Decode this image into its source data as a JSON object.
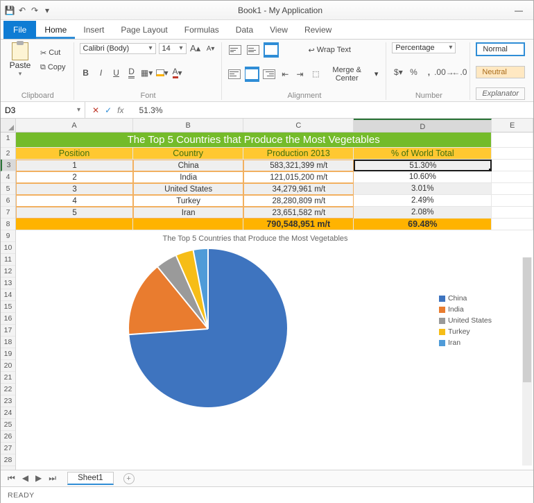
{
  "window": {
    "title": "Book1 - My Application"
  },
  "tabs": {
    "file": "File",
    "home": "Home",
    "insert": "Insert",
    "page_layout": "Page Layout",
    "formulas": "Formulas",
    "data": "Data",
    "view": "View",
    "review": "Review",
    "active": "Home"
  },
  "ribbon": {
    "clipboard": {
      "paste": "Paste",
      "cut": "Cut",
      "copy": "Copy",
      "label": "Clipboard"
    },
    "font": {
      "name_sel": "Calibri (Body)",
      "size_sel": "14",
      "label": "Font"
    },
    "alignment": {
      "wrap": "Wrap Text",
      "merge": "Merge & Center",
      "label": "Alignment"
    },
    "number": {
      "format_sel": "Percentage",
      "label": "Number"
    },
    "styles": {
      "normal": "Normal",
      "neutral": "Neutral",
      "explan": "Explanator"
    }
  },
  "formula_bar": {
    "cellref": "D3",
    "value": "51.3%"
  },
  "columns": {
    "A": "A",
    "B": "B",
    "C": "C",
    "D": "D",
    "E": "E"
  },
  "rows_labels": [
    "1",
    "2",
    "3",
    "4",
    "5",
    "6",
    "7",
    "8",
    "9",
    "10",
    "11",
    "12",
    "13",
    "14",
    "15",
    "16",
    "17",
    "18",
    "19",
    "20",
    "21",
    "22",
    "23",
    "24",
    "25",
    "26",
    "27",
    "28"
  ],
  "table": {
    "title": "The Top 5 Countries that Produce the Most Vegetables",
    "headers": {
      "pos": "Position",
      "country": "Country",
      "prod": "Production 2013",
      "pct": "% of World Total"
    },
    "rows": [
      {
        "pos": "1",
        "country": "China",
        "prod": "583,321,399 m/t",
        "pct": "51.30%"
      },
      {
        "pos": "2",
        "country": "India",
        "prod": "121,015,200 m/t",
        "pct": "10.60%"
      },
      {
        "pos": "3",
        "country": "United States",
        "prod": "34,279,961 m/t",
        "pct": "3.01%"
      },
      {
        "pos": "4",
        "country": "Turkey",
        "prod": "28,280,809 m/t",
        "pct": "2.49%"
      },
      {
        "pos": "5",
        "country": "Iran",
        "prod": "23,651,582 m/t",
        "pct": "2.08%"
      }
    ],
    "total": {
      "prod": "790,548,951 m/t",
      "pct": "69.48%"
    }
  },
  "chart": {
    "title": "The Top 5 Countries that Produce the Most Vegetables",
    "legend": [
      {
        "name": "China",
        "color": "#3e74bf"
      },
      {
        "name": "India",
        "color": "#e97c2f"
      },
      {
        "name": "United States",
        "color": "#9a9a9a"
      },
      {
        "name": "Turkey",
        "color": "#f6bd17"
      },
      {
        "name": "Iran",
        "color": "#4f9bd8"
      }
    ]
  },
  "chart_data": {
    "type": "pie",
    "title": "The Top 5 Countries that Produce the Most Vegetables",
    "categories": [
      "China",
      "India",
      "United States",
      "Turkey",
      "Iran"
    ],
    "values": [
      51.3,
      10.6,
      3.01,
      2.49,
      2.08
    ],
    "colors": [
      "#3e74bf",
      "#e97c2f",
      "#9a9a9a",
      "#f6bd17",
      "#4f9bd8"
    ],
    "unit": "% of World Total",
    "legend_position": "right"
  },
  "sheets": {
    "active": "Sheet1"
  },
  "status": {
    "text": "READY"
  }
}
